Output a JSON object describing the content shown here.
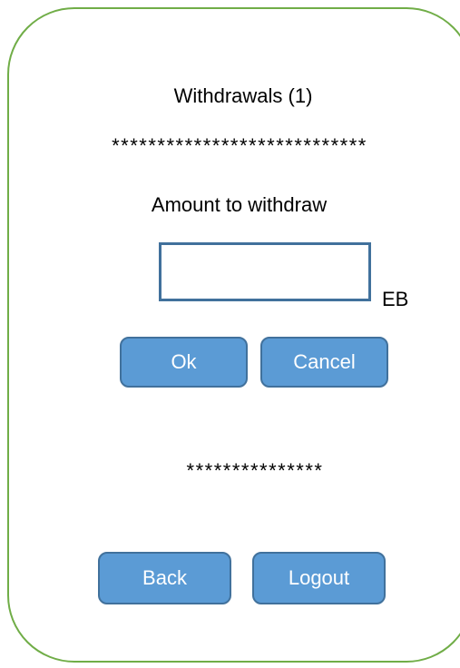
{
  "screen": {
    "title": "Withdrawals (1)",
    "masked_top": "****************************",
    "masked_bottom": "***************"
  },
  "form": {
    "amount_label": "Amount to withdraw",
    "amount_value": "",
    "unit": "EB"
  },
  "actions": {
    "ok_label": "Ok",
    "cancel_label": "Cancel",
    "back_label": "Back",
    "logout_label": "Logout"
  },
  "colors": {
    "frame_border": "#70ad47",
    "button_fill": "#5b9bd5",
    "button_border": "#41719c",
    "input_border": "#41719c"
  }
}
